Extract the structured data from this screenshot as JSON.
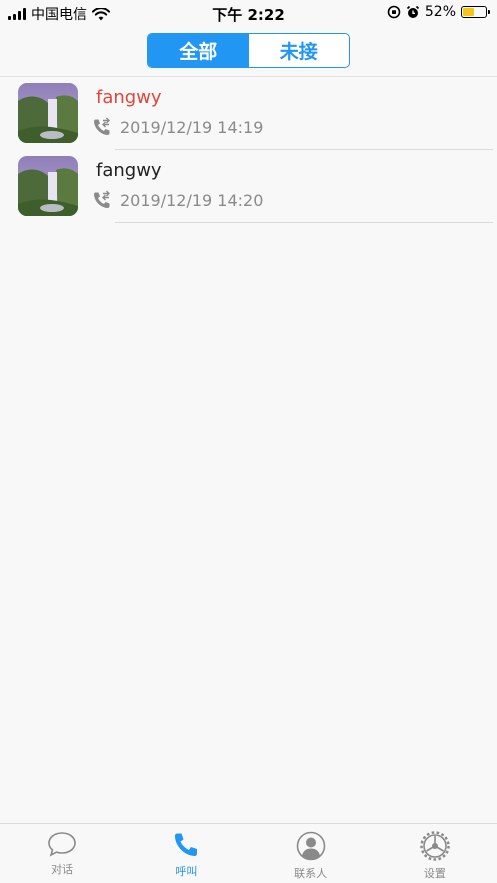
{
  "status_bar": {
    "carrier": "中国电信",
    "time": "下午 2:22",
    "battery_percent": "52%",
    "battery_level": 0.52
  },
  "segmented": {
    "tabs": [
      {
        "label": "全部",
        "active": true
      },
      {
        "label": "未接",
        "active": false
      }
    ]
  },
  "calls": [
    {
      "name": "fangwy",
      "time": "2019/12/19 14:19",
      "missed": true,
      "icon": "outgoing-call-icon"
    },
    {
      "name": "fangwy",
      "time": "2019/12/19 14:20",
      "missed": false,
      "icon": "outgoing-call-icon"
    }
  ],
  "tab_bar": {
    "items": [
      {
        "label": "对话",
        "icon": "chat-bubble-icon",
        "active": false
      },
      {
        "label": "呼叫",
        "icon": "phone-icon",
        "active": true
      },
      {
        "label": "联系人",
        "icon": "contact-icon",
        "active": false
      },
      {
        "label": "设置",
        "icon": "settings-gear-icon",
        "active": false
      }
    ]
  },
  "colors": {
    "accent": "#2196f3",
    "missed": "#e0463a",
    "inactive": "#8a8a8a"
  }
}
